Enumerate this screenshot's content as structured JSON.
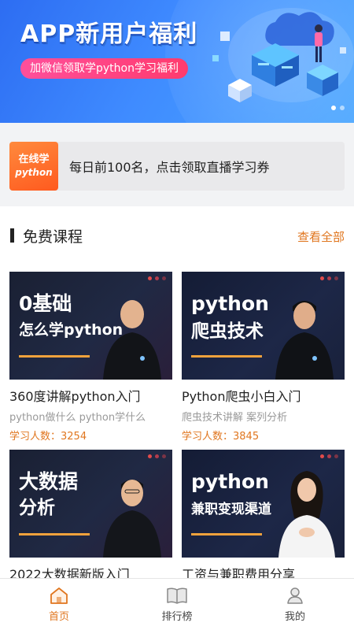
{
  "banner": {
    "title": "APP新用户福利",
    "pill": "加微信领取学python学习福利",
    "dots": 2,
    "active_dot": 0
  },
  "promo": {
    "badge_line1": "在线学",
    "badge_line2": "python",
    "text": "每日前100名，点击领取直播学习券"
  },
  "section": {
    "title": "免费课程",
    "more": "查看全部"
  },
  "courses": [
    {
      "thumb_line1": "0基础",
      "thumb_line2": "怎么学python",
      "title": "360度讲解python入门",
      "subtitle": "python做什么 python学什么",
      "count": "学习人数：3254"
    },
    {
      "thumb_line1": "python",
      "thumb_line2": "爬虫技术",
      "title": "Python爬虫小白入门",
      "subtitle": "爬虫技术讲解 案列分析",
      "count": "学习人数：3845"
    },
    {
      "thumb_line1": "大数据",
      "thumb_line2": "分析",
      "title": "2022大数据新版入门",
      "subtitle": "",
      "count": ""
    },
    {
      "thumb_line1": "python",
      "thumb_line2": "兼职变现渠道",
      "title": "工资与兼职费用分享",
      "subtitle": "",
      "count": ""
    }
  ],
  "tabs": [
    {
      "label": "首页",
      "icon": "home-icon",
      "active": true
    },
    {
      "label": "排行榜",
      "icon": "book-icon",
      "active": false
    },
    {
      "label": "我的",
      "icon": "user-icon",
      "active": false
    }
  ],
  "colors": {
    "accent": "#e0761f",
    "banner_blue": "#3f8bff",
    "pill_pink": "#ff3b6e",
    "badge_orange": "#ff6a2a"
  }
}
